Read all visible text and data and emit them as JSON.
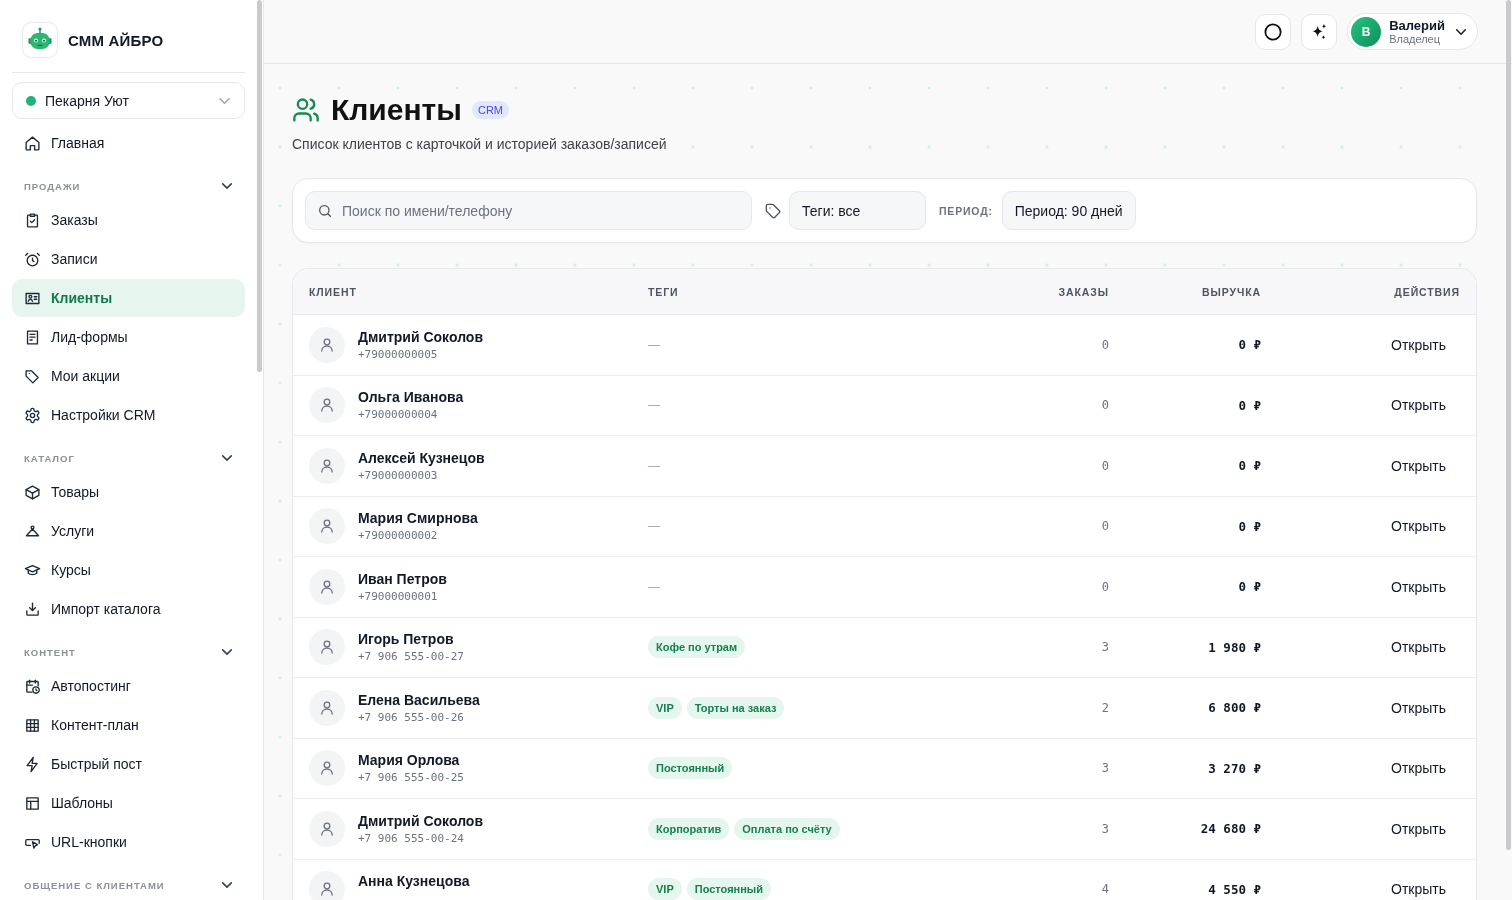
{
  "sidebar": {
    "brand": "СММ АЙБРО",
    "workspace": "Пекарня Уют",
    "items": [
      {
        "label": "Главная",
        "selected": false
      }
    ],
    "sections": [
      {
        "title": "ПРОДАЖИ",
        "expanded": true,
        "items": [
          {
            "label": "Заказы",
            "selected": false
          },
          {
            "label": "Записи",
            "selected": false
          },
          {
            "label": "Клиенты",
            "selected": true
          },
          {
            "label": "Лид-формы",
            "selected": false
          },
          {
            "label": "Мои акции",
            "selected": false
          },
          {
            "label": "Настройки CRM",
            "selected": false
          }
        ]
      },
      {
        "title": "КАТАЛОГ",
        "expanded": true,
        "items": [
          {
            "label": "Товары",
            "selected": false
          },
          {
            "label": "Услуги",
            "selected": false
          },
          {
            "label": "Курсы",
            "selected": false
          },
          {
            "label": "Импорт каталога",
            "selected": false
          }
        ]
      },
      {
        "title": "КОНТЕНТ",
        "expanded": true,
        "items": [
          {
            "label": "Автопостинг",
            "selected": false
          },
          {
            "label": "Контент-план",
            "selected": false
          },
          {
            "label": "Быстрый пост",
            "selected": false
          },
          {
            "label": "Шаблоны",
            "selected": false
          },
          {
            "label": "URL-кнопки",
            "selected": false
          }
        ]
      },
      {
        "title": "ОБЩЕНИЕ С КЛИЕНТАМИ",
        "expanded": true
      }
    ]
  },
  "top_bar": {
    "user": {
      "initial": "В",
      "name": "Валерий",
      "role": "Владелец"
    }
  },
  "header": {
    "title": "Клиенты",
    "badge": "CRM",
    "subtitle": "Список клиентов с карточкой и историей заказов/записей"
  },
  "filters": {
    "search": {
      "placeholder": "Поиск по имени/телефону"
    },
    "tags_select": "Теги: все",
    "period_label": "ПЕРИОД:",
    "period_select": "Период: 90 дней"
  },
  "table": {
    "columns": [
      "КЛИЕНТ",
      "ТЕГИ",
      "ЗАКАЗЫ",
      "ВЫРУЧКА",
      "ДЕЙСТВИЯ"
    ],
    "rows": [
      {
        "name": "Дмитрий Соколов",
        "phone": "+79000000005",
        "tags_empty": "—",
        "orders": "0",
        "revenue": "0 ₽",
        "action": "Открыть"
      },
      {
        "name": "Ольга Иванова",
        "phone": "+79000000004",
        "tags_empty": "—",
        "orders": "0",
        "revenue": "0 ₽",
        "action": "Открыть"
      },
      {
        "name": "Алексей Кузнецов",
        "phone": "+79000000003",
        "tags_empty": "—",
        "orders": "0",
        "revenue": "0 ₽",
        "action": "Открыть"
      },
      {
        "name": "Мария Смирнова",
        "phone": "+79000000002",
        "tags_empty": "—",
        "orders": "0",
        "revenue": "0 ₽",
        "action": "Открыть"
      },
      {
        "name": "Иван Петров",
        "phone": "+79000000001",
        "tags_empty": "—",
        "orders": "0",
        "revenue": "0 ₽",
        "action": "Открыть"
      },
      {
        "name": "Игорь Петров",
        "phone": "+7 906 555-00-27",
        "tags": [
          "Кофе по утрам"
        ],
        "orders": "3",
        "revenue": "1 980 ₽",
        "action": "Открыть"
      },
      {
        "name": "Елена Васильева",
        "phone": "+7 906 555-00-26",
        "tags": [
          "VIP",
          "Торты на заказ"
        ],
        "orders": "2",
        "revenue": "6 800 ₽",
        "action": "Открыть"
      },
      {
        "name": "Мария Орлова",
        "phone": "+7 906 555-00-25",
        "tags": [
          "Постоянный"
        ],
        "orders": "3",
        "revenue": "3 270 ₽",
        "action": "Открыть"
      },
      {
        "name": "Дмитрий Соколов",
        "phone": "+7 906 555-00-24",
        "tags": [
          "Корпоратив",
          "Оплата по счёту"
        ],
        "orders": "3",
        "revenue": "24 680 ₽",
        "action": "Открыть"
      },
      {
        "name": "Анна Кузнецова",
        "tags": [
          "VIP",
          "Постоянный"
        ],
        "orders": "4",
        "revenue": "4 550 ₽",
        "action": "Открыть"
      }
    ]
  }
}
